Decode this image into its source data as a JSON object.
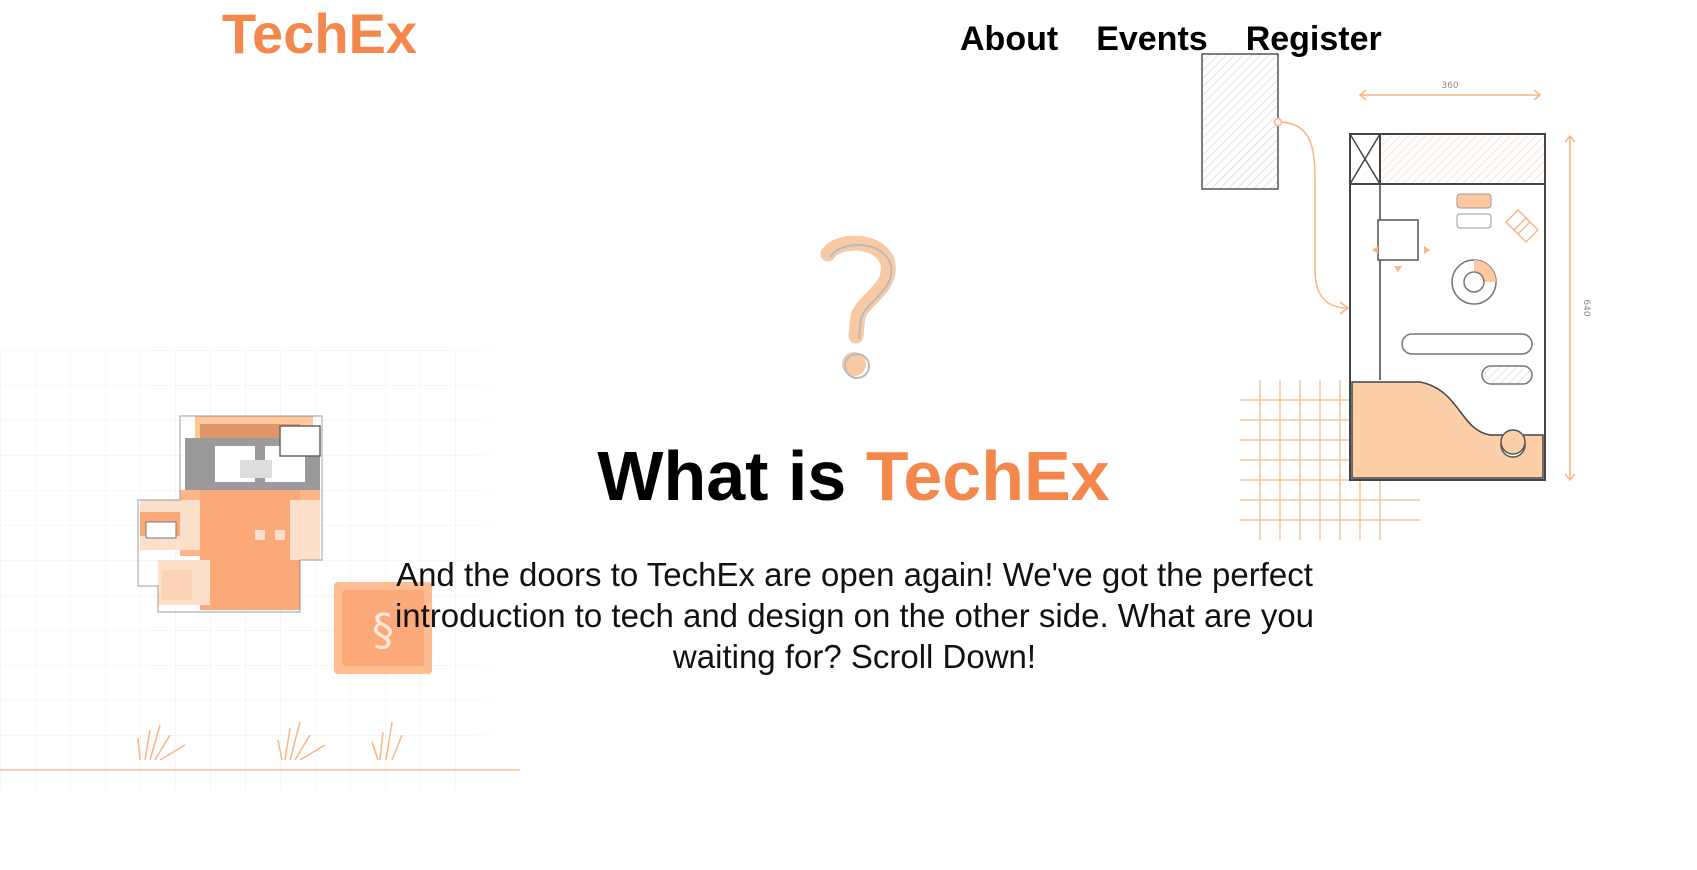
{
  "brand": {
    "logo": "TechEx",
    "accent_color": "#f4874b",
    "text_color": "#000000"
  },
  "nav": {
    "items": [
      {
        "label": "About"
      },
      {
        "label": "Events"
      },
      {
        "label": "Register"
      }
    ]
  },
  "hero": {
    "headline_prefix": "What is ",
    "headline_accent": "TechEx",
    "intro": "And the doors to TechEx are open again! We've got the perfect introduction to tech and design on the other side. What are you waiting for? Scroll Down!"
  },
  "illustrations": {
    "left": "pixel-game-character-icon",
    "center": "question-mark-icon",
    "right": "wireframe-sketch-icon",
    "wireframe_width_label": "360",
    "wireframe_height_label": "640"
  }
}
